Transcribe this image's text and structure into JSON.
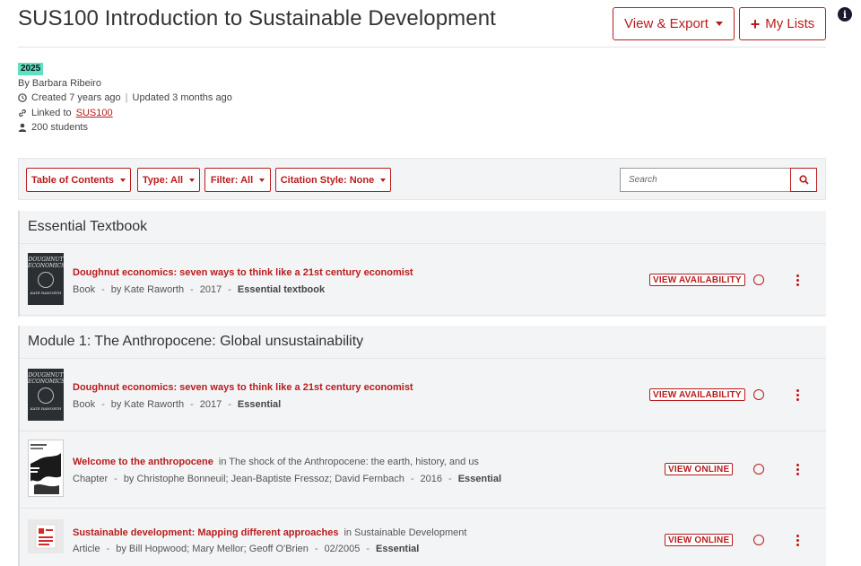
{
  "header": {
    "title": "SUS100 Introduction to Sustainable Development",
    "view_export_label": "View & Export",
    "my_lists_label": "My Lists",
    "info_glyph": "i"
  },
  "meta": {
    "year_badge": "2025",
    "author_line": "By Barbara Ribeiro",
    "created": "Created 7 years ago",
    "separator": "|",
    "updated": "Updated 3 months ago",
    "linked_prefix": "Linked to",
    "linked_code": "SUS100",
    "students": "200 students"
  },
  "toolbar": {
    "toc_label": "Table of Contents",
    "type_label": "Type: All",
    "filter_label": "Filter: All",
    "citation_label": "Citation Style: None",
    "search_placeholder": "Search"
  },
  "sections": [
    {
      "heading": "Essential Textbook",
      "items": [
        {
          "title": "Doughnut economics: seven ways to think like a 21st century economist",
          "in_text": "",
          "type": "Book",
          "authors": "by Kate Raworth",
          "year": "2017",
          "importance": "Essential textbook",
          "action": "VIEW AVAILABILITY"
        }
      ]
    },
    {
      "heading": "Module 1: The Anthropocene: Global unsustainability",
      "items": [
        {
          "title": "Doughnut economics: seven ways to think like a 21st century economist",
          "in_text": "",
          "type": "Book",
          "authors": "by Kate Raworth",
          "year": "2017",
          "importance": "Essential",
          "action": "VIEW AVAILABILITY"
        },
        {
          "title": "Welcome to the anthropocene",
          "in_text": "in The shock of the Anthropocene: the earth, history, and us",
          "type": "Chapter",
          "authors": "by Christophe Bonneuil; Jean-Baptiste Fressoz; David Fernbach",
          "year": "2016",
          "importance": "Essential",
          "action": "VIEW ONLINE"
        },
        {
          "title": "Sustainable development: Mapping different approaches",
          "in_text": "in Sustainable Development",
          "type": "Article",
          "authors": "by Bill Hopwood; Mary Mellor; Geoff O'Brien",
          "year": "02/2005",
          "importance": "Essential",
          "action": "VIEW ONLINE"
        }
      ]
    }
  ],
  "covers": {
    "doughnut_text_1": "DOUGHNUT",
    "doughnut_text_2": "ECONOMICS",
    "doughnut_author": "KATE RAWORTH"
  },
  "colors": {
    "accent": "#b91c1c",
    "badge": "#5fe0c4",
    "panel": "#f3f4f5"
  },
  "icons": {
    "clock": "clock-icon",
    "link": "link-icon",
    "user": "user-icon",
    "search": "search-icon",
    "info": "info-icon",
    "plus": "plus-icon",
    "kebab": "kebab-menu-icon",
    "circle": "status-circle-icon"
  }
}
